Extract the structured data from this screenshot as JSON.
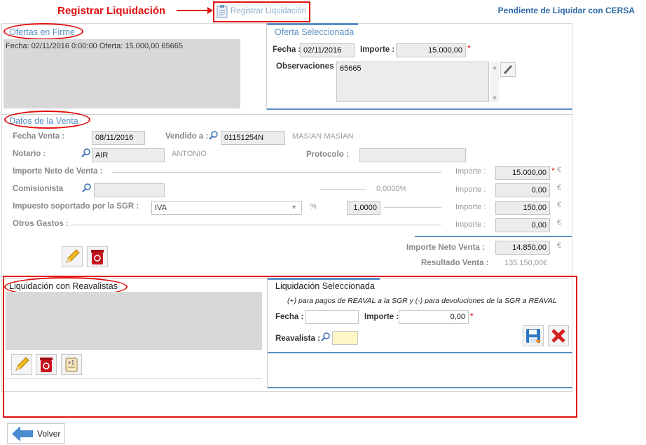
{
  "annotation": {
    "label": "Registrar Liquidación"
  },
  "toolbar": {
    "register_label": "Registrar Liquidación"
  },
  "header": {
    "status": "Pendiente de Liquidar con CERSA"
  },
  "ofertas": {
    "title": "Ofertas en Firme",
    "items": [
      "Fecha: 02/11/2016 0:00:00 Oferta: 15.000,00 65665"
    ]
  },
  "oferta_sel": {
    "title": "Oferta Seleccionada",
    "fecha_label": "Fecha :",
    "fecha": "02/11/2016",
    "importe_label": "Importe :",
    "importe": "15.000,00",
    "obs_label": "Observaciones :",
    "obs": "65665"
  },
  "venta": {
    "title": "Datos de la Venta",
    "fecha_label": "Fecha Venta :",
    "fecha": "08/11/2016",
    "vendido_label": "Vendido a :",
    "vendido_id": "01151254N",
    "vendido_name": "MASIAN MASIAN",
    "notario_label": "Notario :",
    "notario_code": "AIR",
    "notario_name": "ANTONIO",
    "protocolo_label": "Protocolo :",
    "protocolo": "",
    "importe_neto_label": "Importe Neto de Venta :",
    "importe_label": "Importe :",
    "importe_neto": "15.000,00",
    "comisionista_label": "Comisionista",
    "comisionista": "",
    "comision_pct": "0,0000%",
    "comision_importe": "0,00",
    "impuesto_label": "Impuesto soportado por la SGR :",
    "impuesto_sel": "IVA",
    "pct_symbol": "%",
    "impuesto_pct": "1,0000",
    "impuesto_importe": "150,00",
    "otros_label": "Otros Gastos :",
    "otros_importe": "0,00",
    "neto_venta_label": "Importe Neto Venta :",
    "neto_venta": "14.850,00",
    "resultado_label": "Resultado Venta :",
    "resultado": "135.150,00€",
    "currency": "€"
  },
  "reavalistas": {
    "title": "Liquidación con Reavalistas"
  },
  "liq_sel": {
    "title": "Liquidación Seleccionada",
    "note": "(+) para pagos de REAVAL a la SGR y (-) para devoluciones de la SGR a REAVAL",
    "fecha_label": "Fecha :",
    "fecha": "",
    "importe_label": "Importe :",
    "importe": "0,00",
    "reavalista_label": "Reavalista :",
    "reavalista": ""
  },
  "footer": {
    "volver_label": "Volver"
  },
  "colors": {
    "accent": "#5a8fc4",
    "annotation": "#e01010"
  }
}
